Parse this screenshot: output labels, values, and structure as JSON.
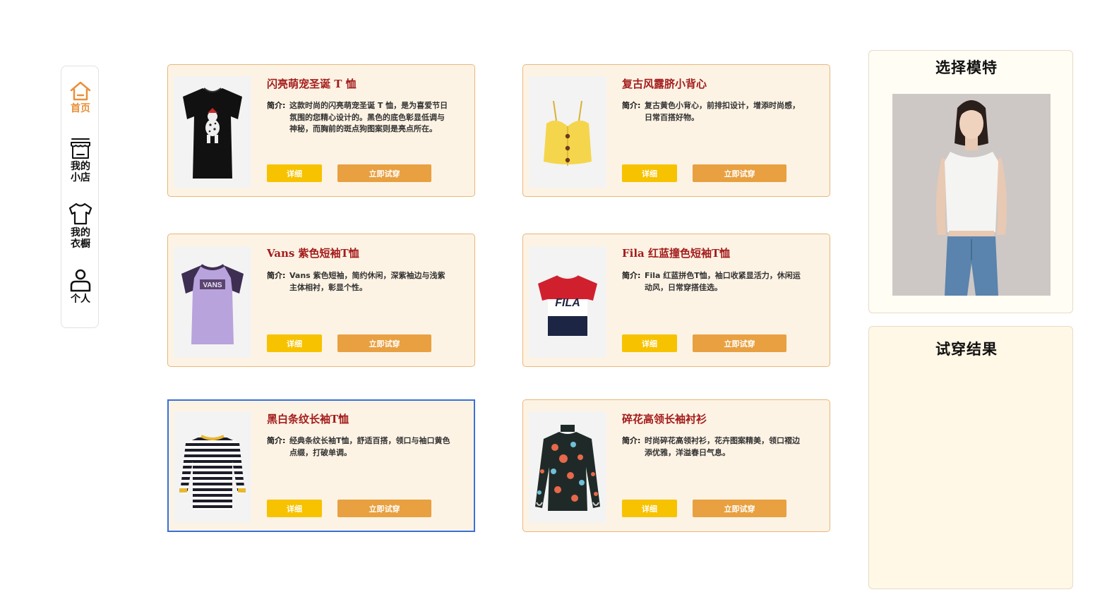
{
  "sidebar": {
    "items": [
      {
        "label": "首页",
        "icon": "home-icon",
        "active": true
      },
      {
        "label": "我的小店",
        "icon": "store-icon",
        "active": false
      },
      {
        "label": "我的衣橱",
        "icon": "shirt-icon",
        "active": false
      },
      {
        "label": "个人",
        "icon": "person-icon",
        "active": false
      }
    ]
  },
  "products": [
    {
      "title": "闪亮萌宠圣诞 T 恤",
      "desc_label": "简介:",
      "desc": "这款时尚的闪亮萌宠圣诞 T 恤，是为喜爱节日氛围的您精心设计的。黑色的底色彰显低调与神秘，而胸前的斑点狗图案则是亮点所在。",
      "detail_label": "详细",
      "try_label": "立即试穿"
    },
    {
      "title": "复古风露脐小背心",
      "desc_label": "简介:",
      "desc": "复古黄色小背心，前排扣设计，增添时尚感，日常百搭好物。",
      "detail_label": "详细",
      "try_label": "立即试穿"
    },
    {
      "title": "Vans 紫色短袖T恤",
      "desc_label": "简介:",
      "desc": "Vans 紫色短袖，简约休闲，深紫袖边与浅紫主体相衬，彰显个性。",
      "detail_label": "详细",
      "try_label": "立即试穿"
    },
    {
      "title": "Fila 红蓝撞色短袖T恤",
      "desc_label": "简介:",
      "desc": "Fila 红蓝拼色T恤，袖口收紧显活力，休闲运动风，日常穿搭佳选。",
      "detail_label": "详细",
      "try_label": "立即试穿"
    },
    {
      "title": "黑白条纹长袖T恤",
      "desc_label": "简介:",
      "desc": "经典条纹长袖T恤，舒适百搭，领口与袖口黄色点缀，打破单调。",
      "detail_label": "详细",
      "try_label": "立即试穿"
    },
    {
      "title": "碎花高领长袖衬衫",
      "desc_label": "简介:",
      "desc": "时尚碎花高领衬衫，花卉图案精美，领口褶边添优雅，洋溢春日气息。",
      "detail_label": "详细",
      "try_label": "立即试穿"
    }
  ],
  "tshirt_logos": {
    "vans": "VANS",
    "fila": "FILA"
  },
  "model_panel": {
    "title": "选择模特"
  },
  "result_panel": {
    "title": "试穿结果"
  },
  "colors": {
    "accent": "#e8913a",
    "card_bg": "#fdf3e4",
    "card_border": "#e8b67a",
    "title_red": "#a31c1c",
    "detail_btn": "#f7c200",
    "try_btn": "#e8a040",
    "selected_border": "#3a6fd8"
  }
}
